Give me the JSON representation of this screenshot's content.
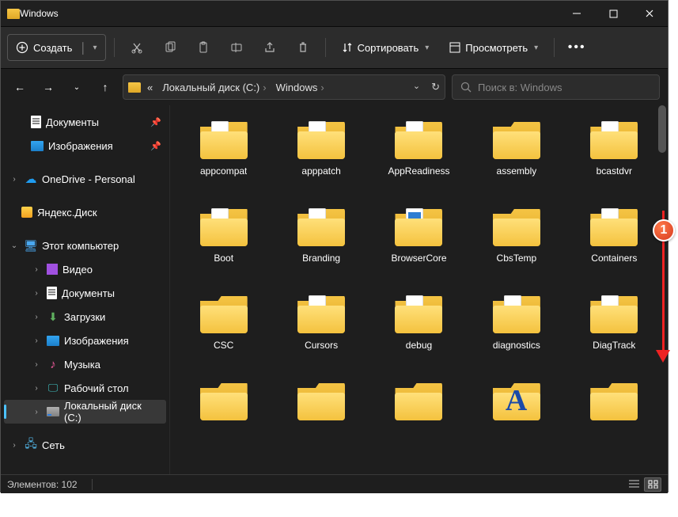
{
  "window": {
    "title": "Windows"
  },
  "toolbar": {
    "create": "Создать",
    "sort": "Сортировать",
    "view": "Просмотреть"
  },
  "breadcrumbs": {
    "root_prefix": "«",
    "drive": "Локальный диск (C:)",
    "folder": "Windows"
  },
  "search": {
    "placeholder": "Поиск в: Windows"
  },
  "sidebar": {
    "documents": "Документы",
    "pictures": "Изображения",
    "onedrive": "OneDrive - Personal",
    "yandex": "Яндекс.Диск",
    "thispc": "Этот компьютер",
    "video": "Видео",
    "documents2": "Документы",
    "downloads": "Загрузки",
    "pictures2": "Изображения",
    "music": "Музыка",
    "desktop": "Рабочий стол",
    "cdrive": "Локальный диск (C:)",
    "network": "Сеть"
  },
  "folders": [
    {
      "name": "appcompat",
      "paper": true
    },
    {
      "name": "apppatch",
      "paper": true
    },
    {
      "name": "AppReadiness",
      "paper": true
    },
    {
      "name": "assembly",
      "plain": true
    },
    {
      "name": "bcastdvr",
      "paper": true
    },
    {
      "name": "Boot",
      "paper": true
    },
    {
      "name": "Branding",
      "paper": true
    },
    {
      "name": "BrowserCore",
      "blue": true
    },
    {
      "name": "CbsTemp",
      "plain": true
    },
    {
      "name": "Containers",
      "paper": true
    },
    {
      "name": "CSC",
      "plain": true
    },
    {
      "name": "Cursors",
      "paper": true
    },
    {
      "name": "debug",
      "paper": true
    },
    {
      "name": "diagnostics",
      "paper": true
    },
    {
      "name": "DiagTrack",
      "paper": true
    },
    {
      "name": "",
      "plain": true
    },
    {
      "name": "",
      "plain": true
    },
    {
      "name": "",
      "plain": true
    },
    {
      "name": "",
      "font": true
    },
    {
      "name": "",
      "plain": true
    }
  ],
  "status": {
    "items_label": "Элементов:",
    "count": "102"
  },
  "annotation": {
    "badge": "1"
  }
}
